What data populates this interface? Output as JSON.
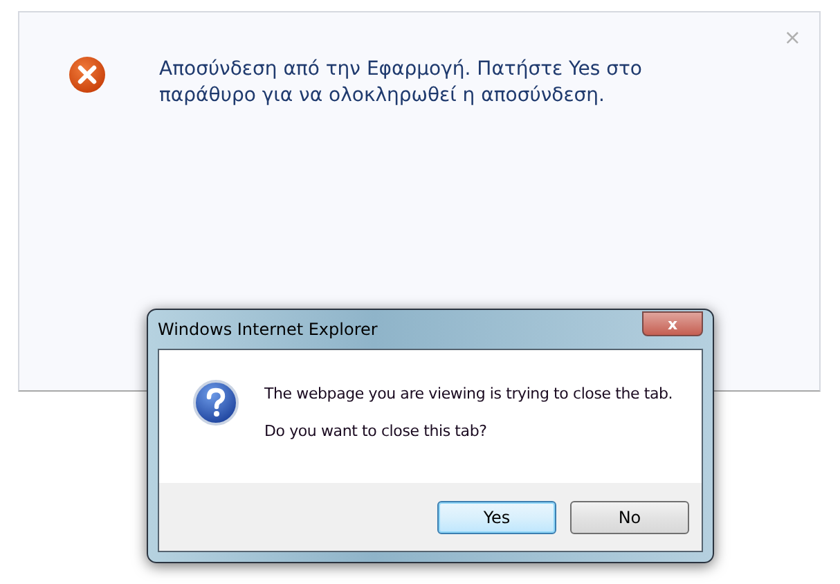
{
  "notification": {
    "close_glyph": "×",
    "message": "Αποσύνδεση από την Εφαρμογή. Πατήστε Yes στο παράθυρο για να ολοκληρωθεί η αποσύνδεση."
  },
  "dialog": {
    "title": "Windows Internet Explorer",
    "close_glyph": "x",
    "lines": [
      "The webpage you are viewing is trying to close the tab.",
      "Do you want to close this tab?"
    ],
    "buttons": [
      {
        "label": "Yes",
        "default": true
      },
      {
        "label": "No",
        "default": false
      }
    ]
  }
}
